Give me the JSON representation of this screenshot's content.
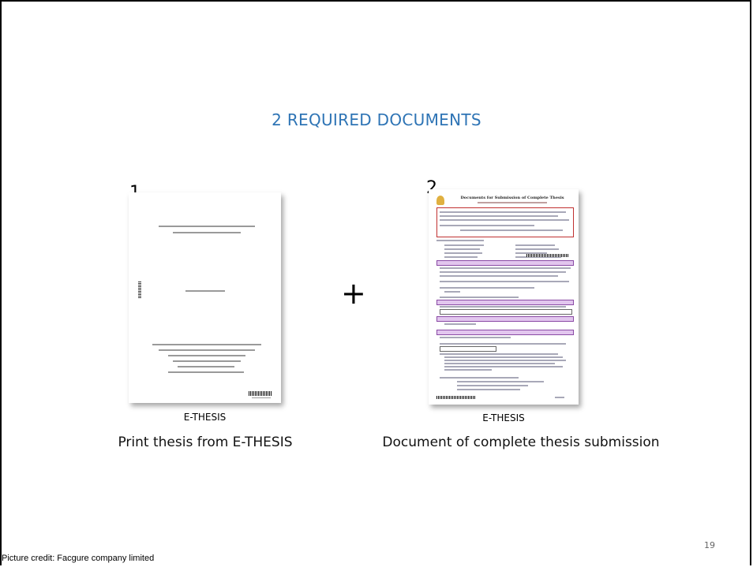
{
  "slide": {
    "title": "2 REQUIRED DOCUMENTS",
    "page_number": "19",
    "credit": "Picture credit: Facgure company limited"
  },
  "documents": [
    {
      "number": "1",
      "label": "E-THESIS",
      "caption": "Print thesis from E-THESIS"
    },
    {
      "number": "2",
      "label": "E-THESIS",
      "caption": "Document of complete thesis submission"
    }
  ],
  "plus_symbol": "+",
  "doc2_header": {
    "title": "Documents for Submission of Complete Thesis"
  }
}
